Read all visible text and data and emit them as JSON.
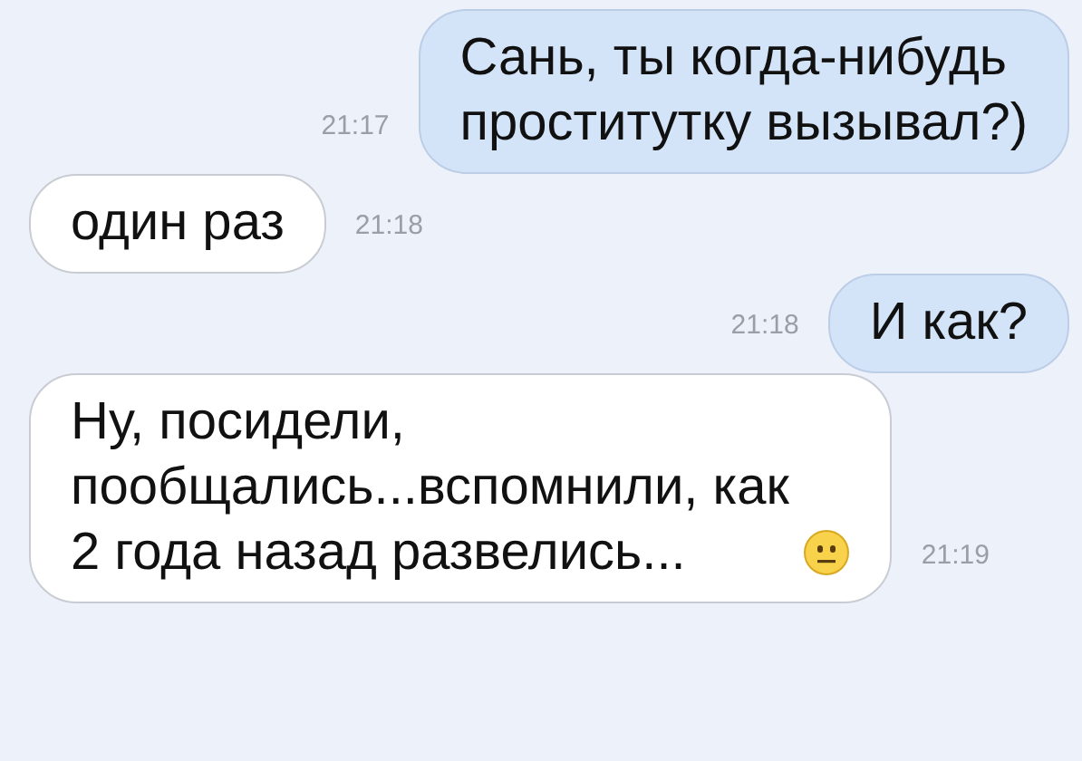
{
  "messages": [
    {
      "kind": "outgoing",
      "text": "Сань, ты когда-нибудь\nпроститутку вызывал?)",
      "time": "21:17"
    },
    {
      "kind": "incoming",
      "text": "один раз",
      "time": "21:18"
    },
    {
      "kind": "outgoing",
      "text": "И как?",
      "time": "21:18"
    },
    {
      "kind": "incoming",
      "text": "Ну, посидели,\nпообщались...вспомнили, как\n2 года назад развелись...",
      "time": "21:19",
      "emoji": true
    }
  ]
}
